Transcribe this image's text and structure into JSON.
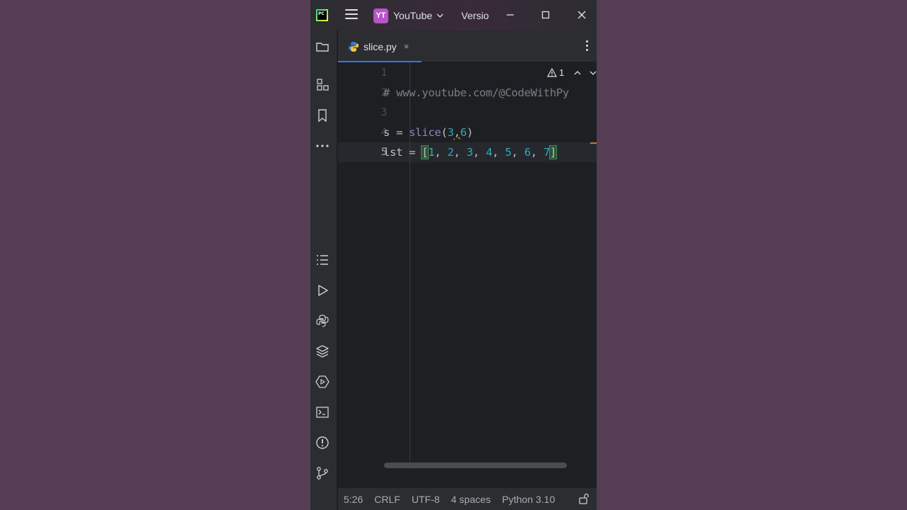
{
  "titlebar": {
    "logo_text": "PC",
    "project_badge": "YT",
    "project_name": "YouTube",
    "vcs_label": "Versio"
  },
  "toolstrip": {
    "top_tools": [
      "project-folder-icon",
      "structure-icon",
      "bookmarks-icon",
      "more-icon"
    ],
    "bottom_tools": [
      "todo-list-icon",
      "run-icon",
      "python-console-icon",
      "layers-icon",
      "services-icon",
      "terminal-icon",
      "problems-icon",
      "git-icon"
    ]
  },
  "tabs": [
    {
      "label": "slice.py",
      "close": "×",
      "icon": "python-icon",
      "active": true
    }
  ],
  "editor": {
    "warning_count": "1",
    "lines": [
      {
        "number": "1",
        "text": ""
      },
      {
        "number": "2",
        "text": "# www.youtube.com/@CodeWithPy"
      },
      {
        "number": "3",
        "text": ""
      },
      {
        "number": "4",
        "tokens": [
          "s = ",
          "slice",
          "(",
          "3",
          ",",
          "6",
          ")"
        ]
      },
      {
        "number": "5",
        "tokens": [
          "lst = ",
          "[",
          "1",
          ", ",
          "2",
          ", ",
          "3",
          ", ",
          "4",
          ", ",
          "5",
          ", ",
          "6",
          ", ",
          "7",
          "]"
        ]
      }
    ]
  },
  "statusbar": {
    "position": "5:26",
    "line_separator": "CRLF",
    "encoding": "UTF-8",
    "indent": "4 spaces",
    "interpreter": "Python 3.10"
  },
  "colors": {
    "background": "#553d53",
    "editor_bg": "#1e1f22",
    "panel_bg": "#2b2d30",
    "accent": "#3574f0",
    "number": "#2aacb8",
    "builtin": "#8888c6",
    "comment": "#7a7e85"
  }
}
